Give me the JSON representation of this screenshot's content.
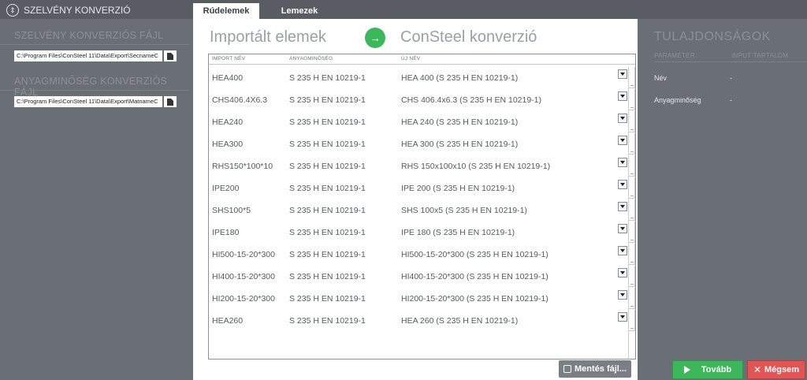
{
  "app": {
    "title": "SZELVÉNY KONVERZIÓ",
    "icon": "sort-circle-icon"
  },
  "tabs": [
    {
      "label": "Rúdelemek",
      "active": true
    },
    {
      "label": "Lemezek",
      "active": false
    }
  ],
  "left": {
    "section1_title": "SZELVÉNY KONVERZIÓS FÁJL",
    "section1_path": "C:\\Program Files\\ConSteel 11\\Data\\Export\\SecnameC",
    "section2_title": "ANYAGMINŐSÉG KONVERZIÓS FÁJL",
    "section2_path": "C:\\Program Files\\ConSteel 11\\Data\\Export\\MatnameC"
  },
  "center": {
    "left_title": "Importált elemek",
    "right_title": "ConSteel konverzió",
    "columns": [
      "IMPORT NÉV",
      "ANYAGMINŐSÉG",
      "ÚJ NÉV"
    ],
    "rows": [
      {
        "import": "HEA400",
        "material": "S 235 H EN 10219-1",
        "new": "HEA 400 (S 235 H EN 10219-1)"
      },
      {
        "import": "CHS406.4X6.3",
        "material": "S 235 H EN 10219-1",
        "new": "CHS 406.4x6.3 (S 235 H EN 10219-1)"
      },
      {
        "import": "HEA240",
        "material": "S 235 H EN 10219-1",
        "new": "HEA 240 (S 235 H EN 10219-1)"
      },
      {
        "import": "HEA300",
        "material": "S 235 H EN 10219-1",
        "new": "HEA 300 (S 235 H EN 10219-1)"
      },
      {
        "import": "RHS150*100*10",
        "material": "S 235 H EN 10219-1",
        "new": "RHS 150x100x10 (S 235 H EN 10219-1)"
      },
      {
        "import": "IPE200",
        "material": "S 235 H EN 10219-1",
        "new": "IPE 200 (S 235 H EN 10219-1)"
      },
      {
        "import": "SHS100*5",
        "material": "S 235 H EN 10219-1",
        "new": "SHS 100x5 (S 235 H EN 10219-1)"
      },
      {
        "import": "IPE180",
        "material": "S 235 H EN 10219-1",
        "new": "IPE 180 (S 235 H EN 10219-1)"
      },
      {
        "import": "HI500-15-20*300",
        "material": "S 235 H EN 10219-1",
        "new": "HI500-15-20*300 (S 235 H EN 10219-1)"
      },
      {
        "import": "HI400-15-20*300",
        "material": "S 235 H EN 10219-1",
        "new": "HI400-15-20*300 (S 235 H EN 10219-1)"
      },
      {
        "import": "HI200-15-20*300",
        "material": "S 235 H EN 10219-1",
        "new": "HI200-15-20*300 (S 235 H EN 10219-1)"
      },
      {
        "import": "HEA260",
        "material": "S 235 H EN 10219-1",
        "new": "HEA 260 (S 235 H EN 10219-1)"
      }
    ],
    "save_label": "Mentés fájl..."
  },
  "right": {
    "title": "TULAJDONSÁGOK",
    "col_param": "PARAMÉTER",
    "col_input": "INPUT TARTALOM",
    "props": [
      {
        "label": "Név",
        "value": "-"
      },
      {
        "label": "Anyagminőség",
        "value": "-"
      }
    ]
  },
  "footer": {
    "next_label": "Tovább",
    "cancel_label": "Mégsem"
  },
  "colors": {
    "accent_green": "#3cb75a",
    "cancel_red": "#e35454",
    "panel_gray": "#6a6e75"
  }
}
